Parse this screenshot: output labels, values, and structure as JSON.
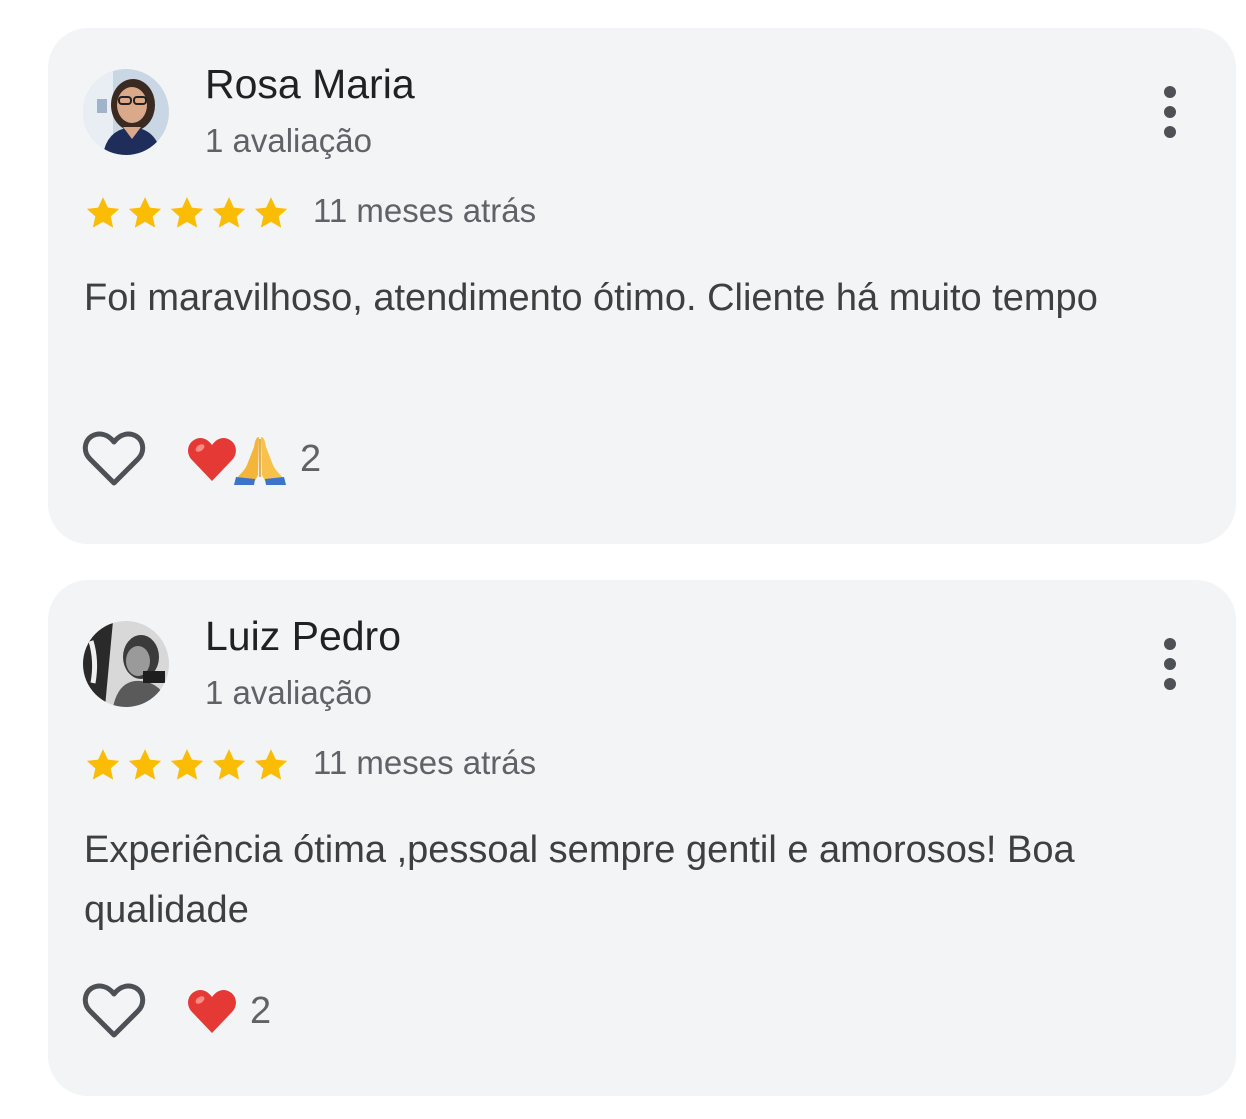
{
  "reviews": [
    {
      "name": "Rosa Maria",
      "review_count": "1 avaliação",
      "rating": 5,
      "date": "11 meses atrás",
      "text": "Foi maravilhoso, atendimento ótimo. Cliente há muito tempo",
      "reactions": [
        "heart-emoji",
        "praying-hands-emoji"
      ],
      "reaction_count": "2"
    },
    {
      "name": "Luiz Pedro",
      "review_count": "1 avaliação",
      "rating": 5,
      "date": "11 meses atrás",
      "text": "Experiência ótima ,pessoal sempre gentil e amorosos! Boa qualidade",
      "reactions": [
        "heart-emoji"
      ],
      "reaction_count": "2"
    }
  ],
  "colors": {
    "card_background": "#f3f4f6",
    "star": "#fbbc04",
    "text_primary": "#202124",
    "text_secondary": "#5f6368",
    "heart": "#e53935"
  }
}
